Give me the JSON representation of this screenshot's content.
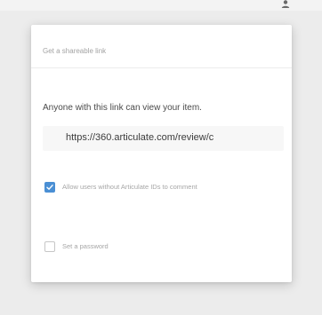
{
  "dialog": {
    "title": "Get a shareable link",
    "description": "Anyone with this link can view your item.",
    "link_value": "https://360.articulate.com/review/c",
    "options": [
      {
        "label": "Allow users without Articulate IDs to comment",
        "checked": true
      },
      {
        "label": "Set a password",
        "checked": false
      }
    ]
  },
  "icons": {
    "top_right": "user-icon",
    "checkbox_mark": "checkmark-icon"
  },
  "colors": {
    "accent": "#4a8fd4",
    "background": "#ececec",
    "card": "#ffffff"
  }
}
